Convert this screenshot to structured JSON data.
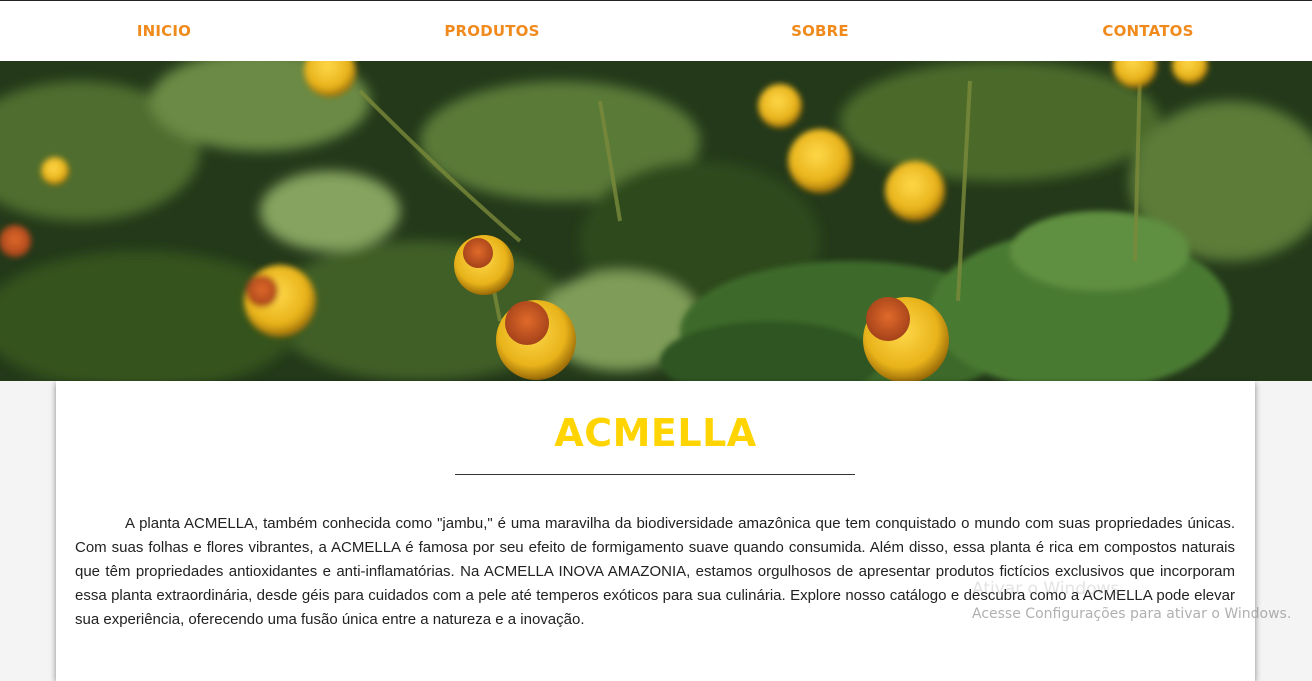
{
  "nav": {
    "items": [
      {
        "label": "INICIO"
      },
      {
        "label": "PRODUTOS"
      },
      {
        "label": "SOBRE"
      },
      {
        "label": "CONTATOS"
      }
    ]
  },
  "colors": {
    "nav_text": "#f08a1c",
    "title": "#ffd400"
  },
  "hero": {
    "image": "acmella-flowers-photo"
  },
  "content": {
    "title": "ACMELLA",
    "paragraph": "A planta ACMELLA, também conhecida como \"jambu,\" é uma maravilha da biodiversidade amazônica que tem conquistado o mundo com suas propriedades únicas. Com suas folhas e flores vibrantes, a ACMELLA é famosa por seu efeito de formigamento suave quando consumida. Além disso, essa planta é rica em compostos naturais que têm propriedades antioxidantes e anti-inflamatórias. Na ACMELLA INOVA AMAZONIA, estamos orgulhosos de apresentar produtos fictícios exclusivos que incorporam essa planta extraordinária, desde géis para cuidados com a pele até temperos exóticos para sua culinária. Explore nosso catálogo e descubra como a ACMELLA pode elevar sua experiência, oferecendo uma fusão única entre a natureza e a inovação."
  },
  "watermark": {
    "line1": "Ativar o Windows",
    "line2": "Acesse Configurações para ativar o Windows."
  }
}
